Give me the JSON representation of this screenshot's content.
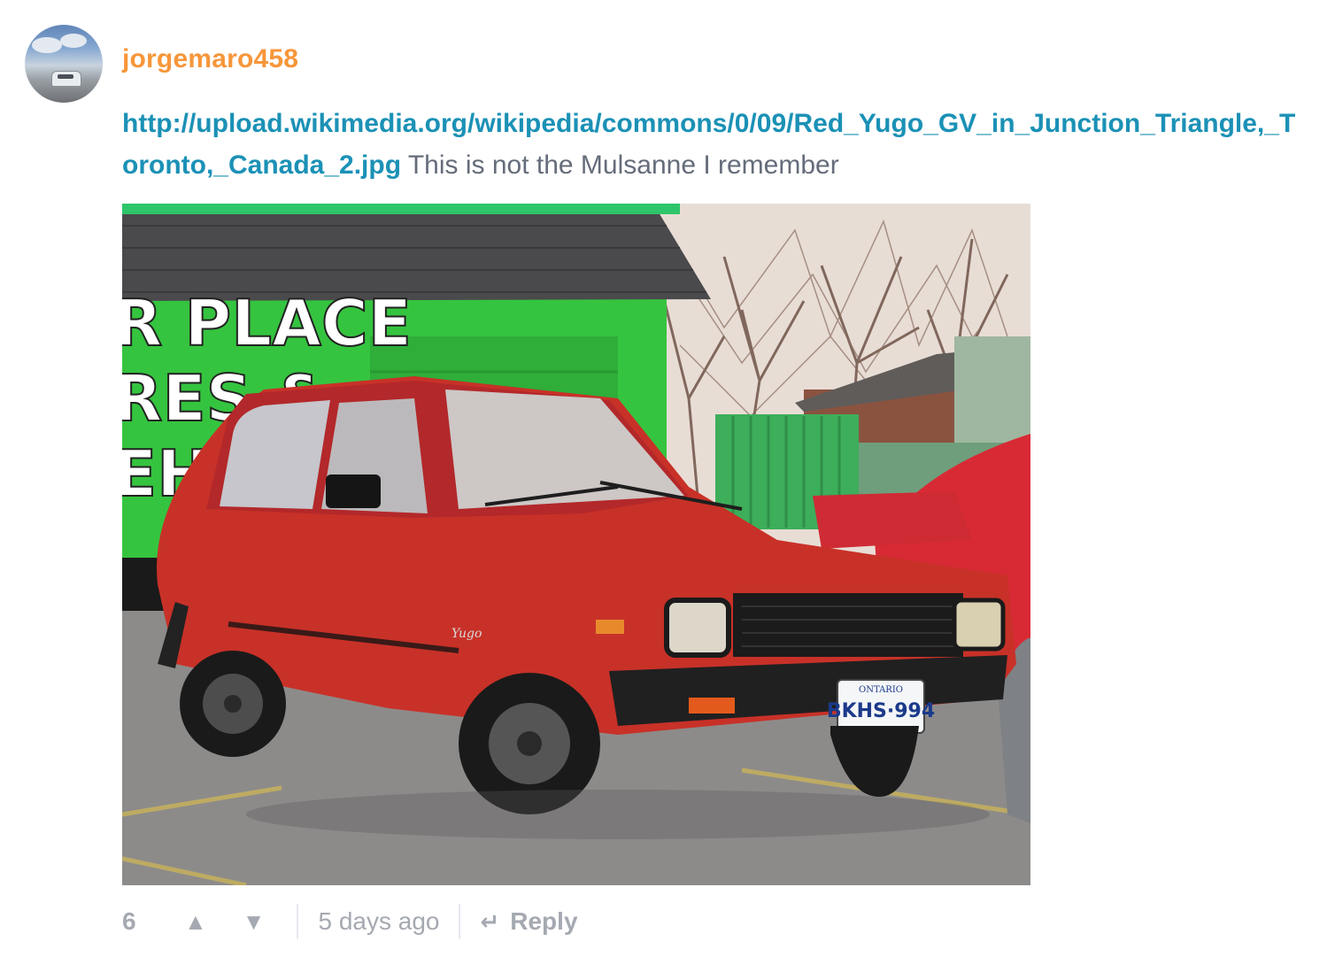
{
  "comment": {
    "username": "jorgemaro458",
    "link_text": "http://upload.wikimedia.org/wikipedia/commons/0/09/Red_Yugo_GV_in_Junction_Triangle,_Toronto,_Canada_2.jpg",
    "text": " This is not the Mulsanne I remember",
    "photo": {
      "sign_line1": "R PLACE",
      "sign_line2": "RES &",
      "sign_line3": "EHICLE",
      "plate_province": "ONTARIO",
      "plate_number": "BKHS·994",
      "badge_text": "Yugo"
    },
    "footer": {
      "votes": "6",
      "upvote_icon": "▲",
      "downvote_icon": "▼",
      "time_ago": "5 days ago",
      "reply_icon": "↵",
      "reply_label": "Reply"
    }
  },
  "colors": {
    "username": "#f7963a",
    "link": "#1b91b6",
    "body_text": "#656c7a",
    "muted": "#a5a9b1"
  }
}
